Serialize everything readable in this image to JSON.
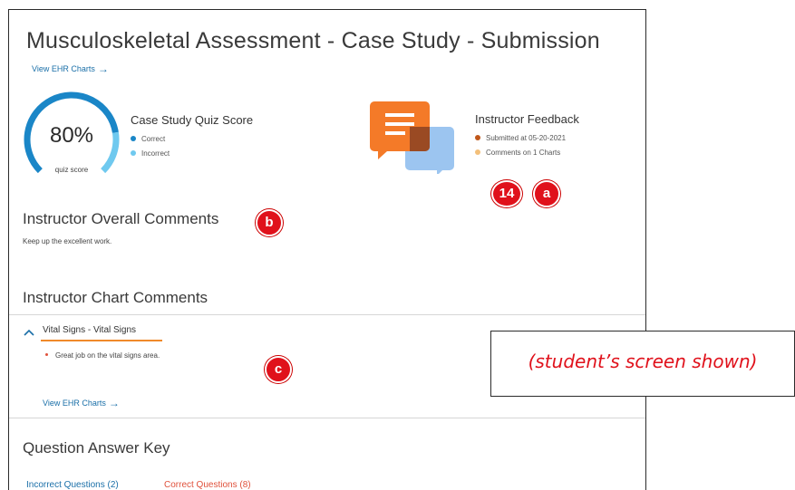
{
  "page": {
    "title": "Musculoskeletal Assessment - Case Study - Submission",
    "view_ehr_link": "View EHR Charts",
    "arrow_glyph": "→"
  },
  "quiz": {
    "score": "80%",
    "score_label": "quiz score",
    "score_fraction": 0.8,
    "heading": "Case Study Quiz Score",
    "legend": [
      {
        "label": "Correct",
        "color": "#1a86c7"
      },
      {
        "label": "Incorrect",
        "color": "#6fc9ef"
      }
    ]
  },
  "feedback": {
    "heading": "Instructor Feedback",
    "items": [
      {
        "label": "Submitted at 05-20-2021",
        "color": "#c0571a"
      },
      {
        "label": "Comments on 1 Charts",
        "color": "#f3c07a"
      }
    ],
    "icon": "speech-bubbles-icon"
  },
  "badges": {
    "step": "14",
    "a": "a",
    "b": "b",
    "c": "c",
    "color": "#e0111b"
  },
  "overall": {
    "heading": "Instructor Overall Comments",
    "text": "Keep up the excellent work."
  },
  "chart_comments": {
    "heading": "Instructor Chart Comments",
    "toggle_glyph": "^",
    "item_title": "Vital Signs - Vital Signs",
    "comment": "Great job on the vital signs area.",
    "view_link": "View EHR Charts"
  },
  "answer_key": {
    "heading": "Question Answer Key",
    "tab_incorrect": "Incorrect Questions (2)",
    "tab_correct": "Correct Questions (8)"
  },
  "note": "(student’s screen shown)"
}
